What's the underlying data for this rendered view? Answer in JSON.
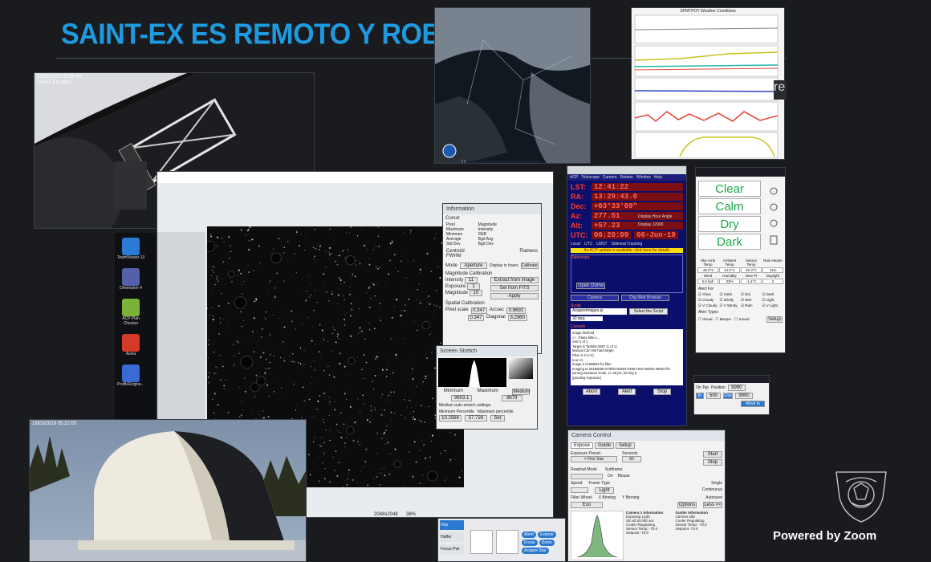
{
  "slide": {
    "title": "SAINT-EX ES REMOTO Y ROBOTICO",
    "watermark": "Powered by Zoom",
    "partial_text": "re"
  },
  "camera_feed_top": {
    "timestamp": "16/03/2019 05:06:44",
    "camera_name": "SAINT-EX cam1"
  },
  "camera_feed_bottom": {
    "timestamp": "16/03/2019 05:22:05"
  },
  "weather_chart": {
    "title": "SPMTPOY Weather Conditions"
  },
  "satellite": {
    "toolbar_text": "22"
  },
  "image_viewer": {
    "size_label": "2048x2048",
    "zoom_label": "38%"
  },
  "info_window": {
    "title": "Information",
    "section_cursor": "Cursor",
    "labels_left": [
      "Pixel",
      "Maximum",
      "Minimum",
      "Average",
      "Std Dev"
    ],
    "labels_right": [
      "Magnitude",
      "Intensity",
      "SNR",
      "Bgd Avg",
      "Bgd Dev"
    ],
    "centroid": "Centroid",
    "centroid_value": "FWHM",
    "flatness": "Flatness",
    "mode_label": "Mode",
    "mode_value": "Aperture",
    "display_hours": "Display in hours",
    "calibrate_btn": "Calibrate",
    "mag_calib": "Magnitude Calibration",
    "intensity_label": "Intensity",
    "intensity_value": "11",
    "exposure_label": "Exposure",
    "exposure_value": "1",
    "magnitude_label": "Magnitude",
    "magnitude_value": "10",
    "extract_btn": "Extract from image",
    "set_fits_btn": "Set from FITS",
    "apply_btn": "Apply",
    "spatial_calib": "Spatial Calibration",
    "pixel_scale_label": "Pixel scale",
    "pixel_scale_x": "0.347",
    "pixel_scale_y": "0.347",
    "arcsec_label": "Arcsec",
    "arcsec_value": "0.8692",
    "diagonal_label": "Diagonal",
    "diagonal_value": "3.2960"
  },
  "screen_stretch": {
    "title": "Screen Stretch",
    "minimum_label": "Minimum",
    "maximum_label": "Maximum",
    "minimum_value": "9603.1",
    "maximum_value": "9679",
    "medium_btn": "Medium",
    "auto_stretch": "Medium auto-stretch settings",
    "min_pct_label": "Minimum Percentile",
    "max_pct_label": "Maximum percentile",
    "min_pct_value": "10.2566",
    "max_pct_value": "57.726",
    "set_btn": "Set"
  },
  "acp": {
    "menu": [
      "ACP",
      "Telescope",
      "Camera",
      "Rotator",
      "Window",
      "Help"
    ],
    "lst_label": "LST:",
    "lst_value": "12:41:22",
    "ra_label": "RA:",
    "ra_value": "13:29:43.0",
    "dec_label": "Dec:",
    "dec_value": "+03°33'09\"",
    "az_label": "Az:",
    "az_value": "277.51",
    "alt_label": "Alt:",
    "alt_value": "+57.23",
    "utc_label": "UTC:",
    "utc_value": "06:20:09",
    "date_value": "06-Jun-19",
    "display_hours_chk": "Display Hour Angle",
    "display_j2000": "Display J2000",
    "radio_local": "Local",
    "radio_utc": "UTC",
    "radio_lmst": "LMST",
    "sidereal": "Sidereal Tracking",
    "update_banner": "An ACP update is available: click here for details",
    "telescope_section": "Telescope",
    "camera_section": "Camera",
    "open_dome_btn": "Open Dome",
    "chg_btn": "Chg Web Browser",
    "script_label": "Script",
    "script_value": "AcquireImages.js",
    "select_script_btn": "Select the Script",
    "plan_value": "30.targ",
    "console_label": "Console",
    "console_lines": [
      "Image finished",
      "c:/...Plans-filter.c...",
      "Sim*1 of 1",
      "Target is TipWiN-2597 (1 of 1)",
      "Manual Can Not hard target",
      "Filter is 2 (I+z)",
      "(Loc 2)",
      "Image 3 of 998/64 for filter",
      "Imaging to 20190606-S7/B/N-NiWiN-0396-10x0-NW/IN-29062.fits",
      "(wrong exposure scale, 1× 48 pix, forcing t)",
      "(pending exposure)"
    ],
    "abort_btn": "Abort",
    "alert_btn": "Alert",
    "stop_btn": "Stop"
  },
  "weather_panel": {
    "conditions": [
      "Clear",
      "Calm",
      "Dry",
      "Dark"
    ],
    "headers": [
      "Sky-Amb Temp",
      "Ambient Temp",
      "Sensor Temp",
      "Rain Heater"
    ],
    "values": [
      "-48.0°C",
      "14.5°C",
      "20.3°C",
      "11%"
    ],
    "headers2": [
      "Wind",
      "Humidity",
      "Dew Pt",
      "Daylight"
    ],
    "values2": [
      "6.6 kph",
      "33%",
      "-1.4°C",
      "2"
    ],
    "alert_for": "Alert For",
    "alerts": [
      "Clear",
      "Calm",
      "Dry",
      "Dark",
      "Cloudy",
      "Windy",
      "Wet",
      "Light",
      "V Cloudy",
      "V Windy",
      "Rain",
      "V Light"
    ],
    "alert_types": "Alert Types",
    "alert_type_opts": [
      "Visual",
      "Beeper",
      "Sound"
    ],
    "setup_btn": "Setup"
  },
  "focus_win": {
    "on_top": "On Top",
    "position_label": "Position",
    "position_value": "9990",
    "move_value": "500",
    "target_value": "9990",
    "in_btn": "In",
    "out_btn": "Out",
    "move_to_btn": "Move to"
  },
  "camera_control": {
    "title": "Camera Control",
    "tabs": [
      "Expose",
      "Guide",
      "Setup"
    ],
    "exposure_preset_label": "Exposure Preset",
    "exposure_preset_value": "< Fine Star",
    "seconds_label": "Seconds",
    "seconds_value": "60",
    "start_btn": "Start",
    "stop_btn": "Stop",
    "readout_label": "Readout Mode",
    "subframe_label": "Subframe",
    "on_label": "On",
    "mouse_label": "Mouse",
    "speed_label": "Speed",
    "frame_type_label": "Frame Type",
    "frame_type_value": "Light",
    "single": "Single",
    "continuous": "Continuous",
    "autosave": "Autosave",
    "options_btn": "Options",
    "filter_wheel_label": "Filter Wheel",
    "filter_value": "Exo",
    "x_bin": "X Binning",
    "y_bin": "Y Binning",
    "less_btn": "Less <<",
    "camera_info_title": "Camera 1 Information",
    "camera_info": [
      "Exposing Light",
      "SE all 30,000 sec",
      "Cooler Regulating",
      "Sensor Temp: -70.0",
      "Setpoint -70.0"
    ],
    "guider_info_title": "Guider Information",
    "guider_info": [
      "Camera Idle",
      "Cooler Regulating",
      "Sensor Temp: -70.0",
      "Setpoint -70.0"
    ]
  },
  "bottom_panel": {
    "left_items": [
      "Hop",
      "Haffer",
      "Focus Pwr"
    ],
    "buttons": [
      "Abort",
      "Expose",
      "Focus",
      "Doms",
      "Acquire Star"
    ]
  },
  "desktop_icons": [
    {
      "label": "TeamViewer 13",
      "color": "#2a7bd6"
    },
    {
      "label": "Dimension 4",
      "color": "#5560a8"
    },
    {
      "label": "ACP Plan Checker",
      "color": "#7bb33a"
    },
    {
      "label": "Aviva",
      "color": "#d43a2a"
    },
    {
      "label": "ProfileEngine...",
      "color": "#3a6ad4"
    }
  ]
}
